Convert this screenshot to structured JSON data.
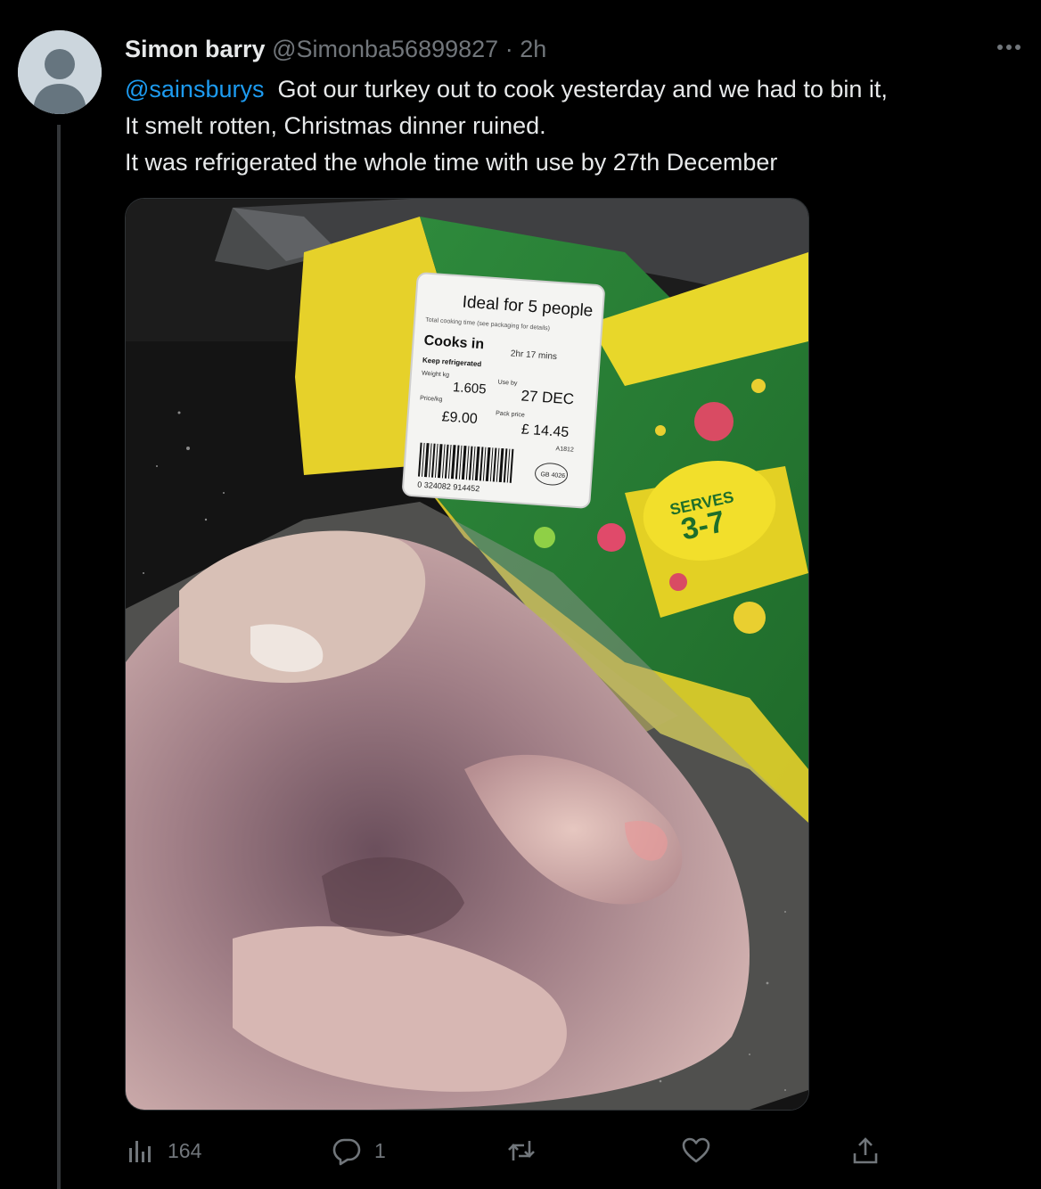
{
  "tweet": {
    "author_name": "Simon barry",
    "author_handle": "@Simonba56899827",
    "separator": "·",
    "time": "2h",
    "mention": "@sainsburys",
    "line1_rest": "Got our turkey out to cook yesterday and we had to bin it,",
    "line2": "It smelt rotten, Christmas dinner ruined.",
    "line3": "It was refrigerated the whole time with use by 27th December"
  },
  "photo_label": {
    "ideal_for": "Ideal for 5 people",
    "total_cooking": "Total cooking time (see packaging for details)",
    "cooks_in": "Cooks in",
    "cook_time": "2hr 17 mins",
    "keep_refrigerated": "Keep refrigerated",
    "weight_label": "Weight kg",
    "weight": "1.605",
    "use_by_label": "Use by",
    "use_by": "27 DEC",
    "price_kg_label": "Price/kg",
    "price_kg": "£9.00",
    "pack_price_label": "Pack price",
    "pack_price": "£ 14.45",
    "code": "A1812",
    "barcode_number": "0 324082 914452",
    "gb_mark": "GB 4026",
    "serves": "SERVES",
    "serves_range": "3-7"
  },
  "actions": {
    "views": "164",
    "replies": "1"
  },
  "colors": {
    "background": "#000000",
    "text": "#e7e9ea",
    "secondary": "#71767b",
    "link": "#1d9bf0"
  },
  "icons": [
    "more-icon",
    "views-icon",
    "reply-icon",
    "retweet-icon",
    "like-icon",
    "share-icon",
    "avatar-placeholder-icon"
  ]
}
